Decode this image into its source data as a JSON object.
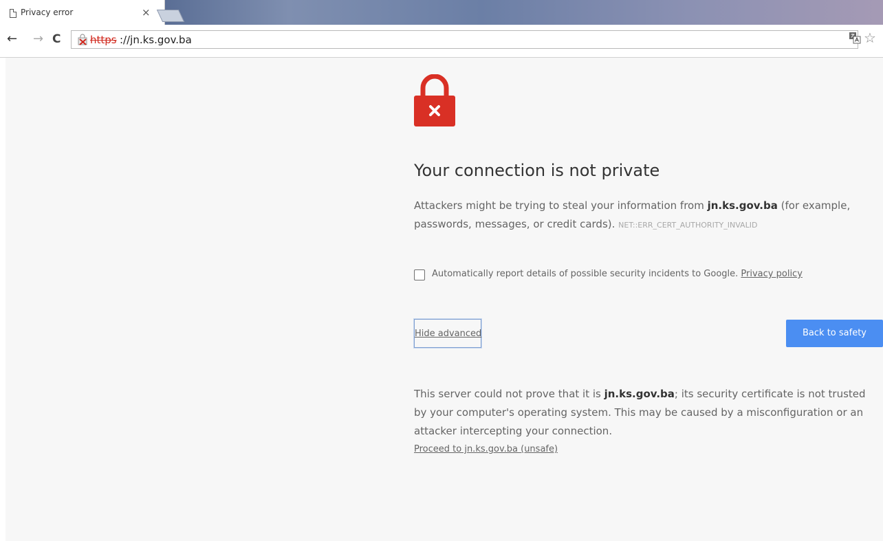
{
  "tab": {
    "title": "Privacy error",
    "close_glyph": "×",
    "icon": "page-icon"
  },
  "toolbar": {
    "back_glyph": "←",
    "forward_glyph": "→",
    "reload_glyph": "C",
    "url_scheme": "https",
    "url_rest": "://jn.ks.gov.ba",
    "security_icon": "broken-lock-icon",
    "translate_icon": "translate-icon",
    "star_glyph": "☆"
  },
  "interstitial": {
    "icon": "red-lock-x-icon",
    "heading": "Your connection is not private",
    "explanation_prefix": "Attackers might be trying to steal your information from ",
    "explanation_domain": "jn.ks.gov.ba",
    "explanation_suffix": " (for example, passwords, messages, or credit cards). ",
    "error_code": "NET::ERR_CERT_AUTHORITY_INVALID",
    "report_label": "Automatically report details of possible security incidents to Google. ",
    "report_link": "Privacy policy",
    "report_checked": false,
    "hide_advanced_label": "Hide advanced",
    "back_to_safety_label": "Back to safety",
    "details_prefix": "This server could not prove that it is ",
    "details_domain": "jn.ks.gov.ba",
    "details_suffix": "; its security certificate is not trusted by your computer's operating system. This may be caused by a misconfiguration or an attacker intercepting your connection.",
    "proceed_link": "Proceed to jn.ks.gov.ba (unsafe)"
  },
  "colors": {
    "page_background": "#f7f7f7",
    "primary_button": "#4b8ef2",
    "error_red": "#d93025"
  }
}
